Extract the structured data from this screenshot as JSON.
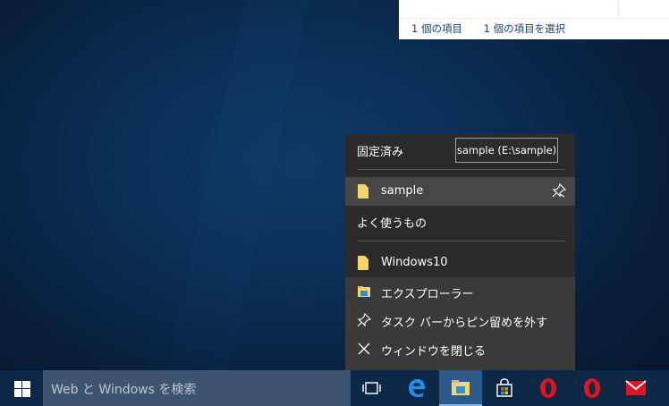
{
  "explorer_status": {
    "item_count": "1 個の項目",
    "selected_count": "1 個の項目を選択"
  },
  "jumplist": {
    "pinned_header": "固定済み",
    "tooltip": "sample (E:\\sample)",
    "pinned_items": [
      {
        "label": "sample",
        "icon": "folder-icon"
      }
    ],
    "frequent_header": "よく使うもの",
    "frequent_items": [
      {
        "label": "Windows10",
        "icon": "folder-icon"
      }
    ],
    "actions": [
      {
        "label": "エクスプローラー",
        "icon": "file-explorer-icon"
      },
      {
        "label": "タスク バーからピン留めを外す",
        "icon": "unpin-icon"
      },
      {
        "label": "ウィンドウを閉じる",
        "icon": "close-icon"
      }
    ]
  },
  "taskbar": {
    "search_placeholder": "Web と Windows を検索",
    "buttons": [
      {
        "name": "task-view-icon"
      },
      {
        "name": "edge-icon"
      },
      {
        "name": "file-explorer-icon",
        "active": true
      },
      {
        "name": "store-icon"
      },
      {
        "name": "opera-icon"
      },
      {
        "name": "opera-icon"
      },
      {
        "name": "mail-icon"
      }
    ]
  },
  "colors": {
    "taskbar": "#0d2847",
    "search_box": "#3d5470",
    "jumplist_bg": "#2b2b2b",
    "jumplist_hover": "#464646",
    "jumplist_actions_bg": "#3a3a3a",
    "folder": "#f5d66a",
    "accent": "#2e5a8a"
  }
}
